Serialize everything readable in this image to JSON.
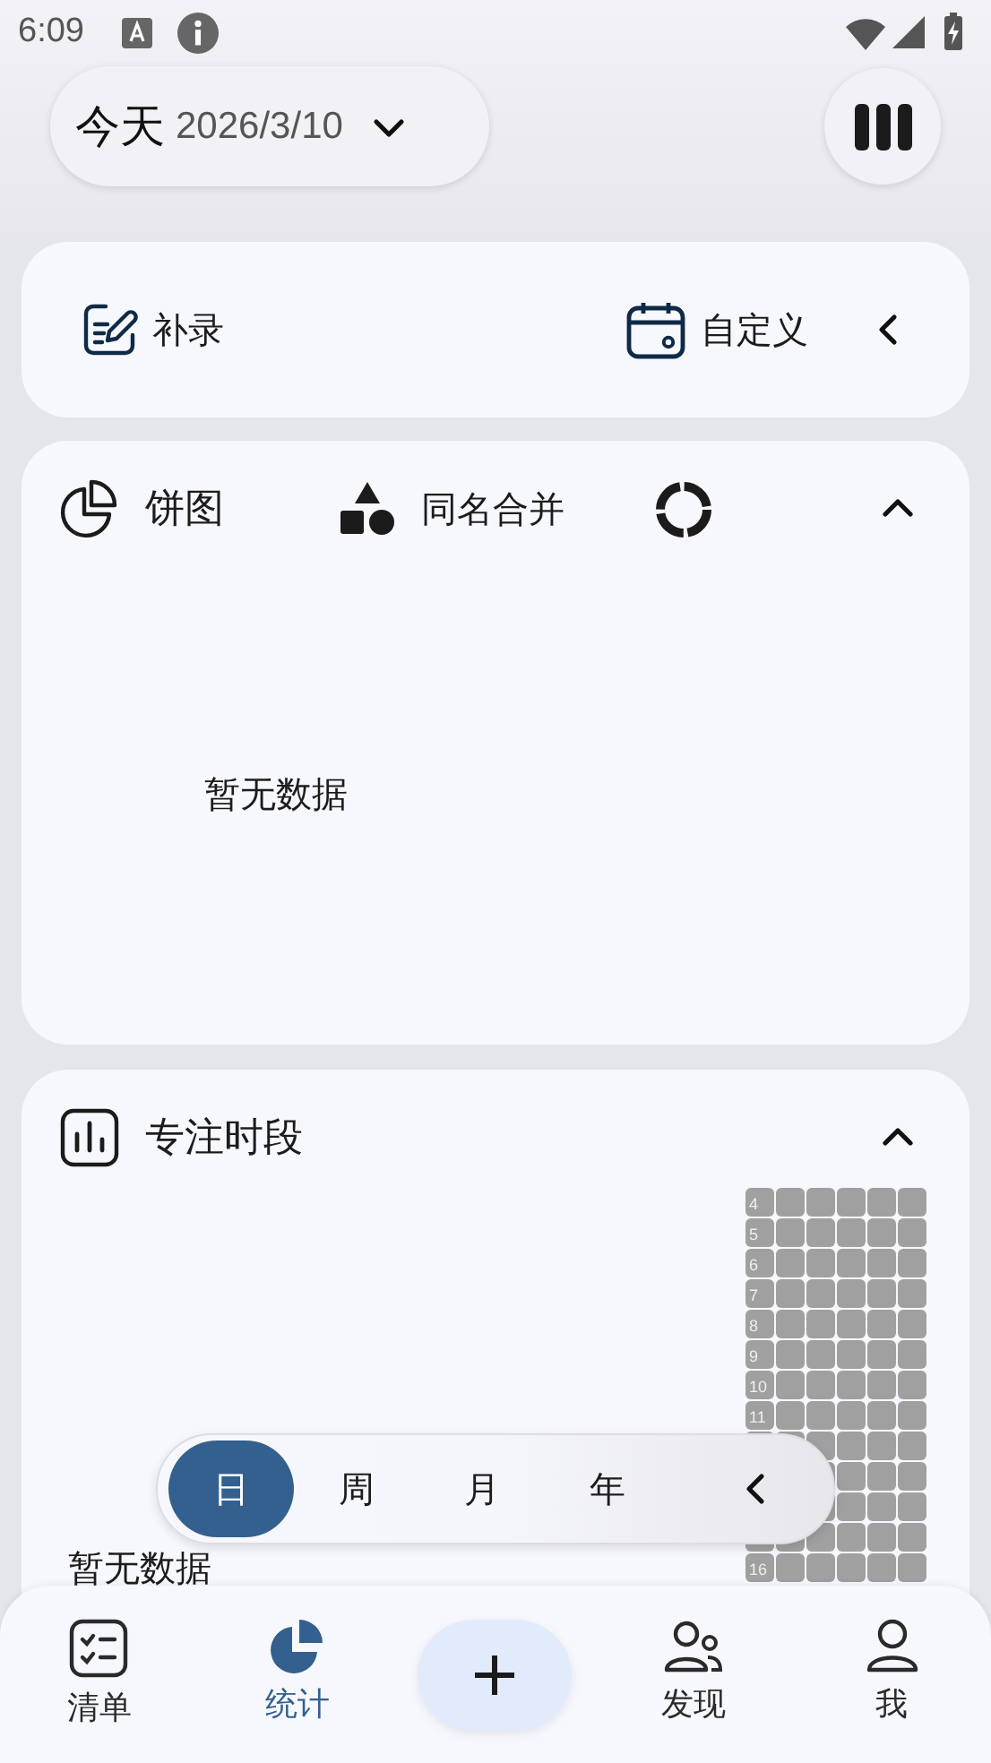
{
  "status_bar": {
    "time": "6:09"
  },
  "date_picker": {
    "label": "今天",
    "date": "2026/3/10"
  },
  "actions": [
    {
      "kind": "backfill",
      "label": "补录"
    },
    {
      "kind": "custom",
      "label": "自定义"
    }
  ],
  "pie_card": {
    "title": "饼图",
    "merge_label": "同名合并",
    "expanded": true,
    "empty_text": "暂无数据"
  },
  "focus_card": {
    "title": "专注时段",
    "expanded": true,
    "empty_text": "暂无数据",
    "hour_rows": [
      {
        "label": "4"
      },
      {
        "label": "5"
      },
      {
        "label": "6"
      },
      {
        "label": "7"
      },
      {
        "label": "8"
      },
      {
        "label": "9"
      },
      {
        "label": "10"
      },
      {
        "label": "11"
      },
      {},
      {},
      {},
      {},
      {
        "label": "16"
      }
    ]
  },
  "periods": [
    {
      "label": "日",
      "selected": true
    },
    {
      "label": "周",
      "selected": false
    },
    {
      "label": "月",
      "selected": false
    },
    {
      "label": "年",
      "selected": false
    }
  ],
  "nav": [
    {
      "kind": "list",
      "label": "清单",
      "selected": false
    },
    {
      "kind": "stats",
      "label": "统计",
      "selected": true
    },
    {
      "kind": "add"
    },
    {
      "kind": "discover",
      "label": "发现",
      "selected": false
    },
    {
      "kind": "me",
      "label": "我",
      "selected": false
    }
  ]
}
